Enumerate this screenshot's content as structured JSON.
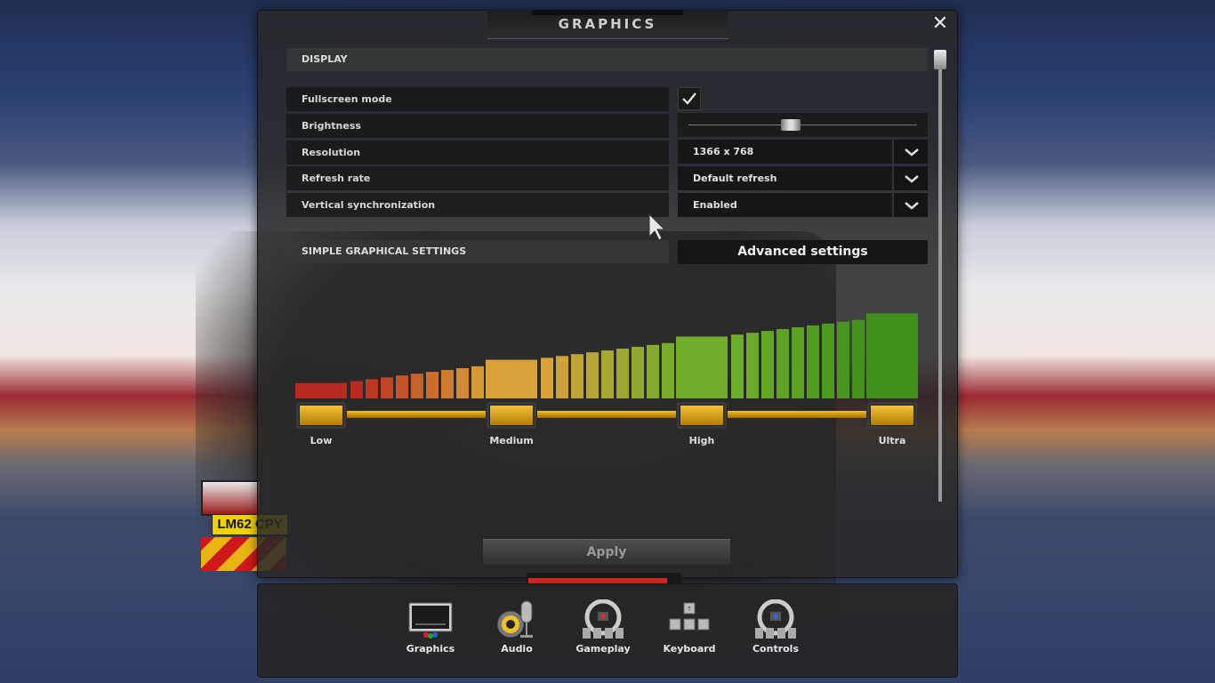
{
  "dialog": {
    "title": "GRAPHICS",
    "close_icon": "close-icon"
  },
  "display": {
    "header": "DISPLAY",
    "rows": [
      {
        "label": "Fullscreen mode",
        "control": "checkbox",
        "checked": true
      },
      {
        "label": "Brightness",
        "control": "slider",
        "value": 0.45
      },
      {
        "label": "Resolution",
        "control": "dropdown",
        "value": "1366 x 768"
      },
      {
        "label": "Refresh rate",
        "control": "dropdown",
        "value": "Default refresh"
      },
      {
        "label": "Vertical synchronization",
        "control": "dropdown",
        "value": "Enabled"
      }
    ]
  },
  "simple": {
    "header": "SIMPLE GRAPHICAL SETTINGS",
    "advanced_button": "Advanced settings",
    "presets": [
      "Low",
      "Medium",
      "High",
      "Ultra"
    ],
    "selected_preset": "Ultra",
    "colors": {
      "low": "#b82a1e",
      "medium": "#d9a13a",
      "high": "#6fae2a",
      "ultra": "#3f8f1c"
    }
  },
  "apply_label": "Apply",
  "nav": [
    {
      "label": "Graphics",
      "icon": "monitor-icon"
    },
    {
      "label": "Audio",
      "icon": "speaker-microphone-icon"
    },
    {
      "label": "Gameplay",
      "icon": "steering-wheel-icon"
    },
    {
      "label": "Keyboard",
      "icon": "keyboard-keys-icon"
    },
    {
      "label": "Controls",
      "icon": "steering-wheel-controller-icon"
    }
  ],
  "plate_text": "LM62 CPY"
}
